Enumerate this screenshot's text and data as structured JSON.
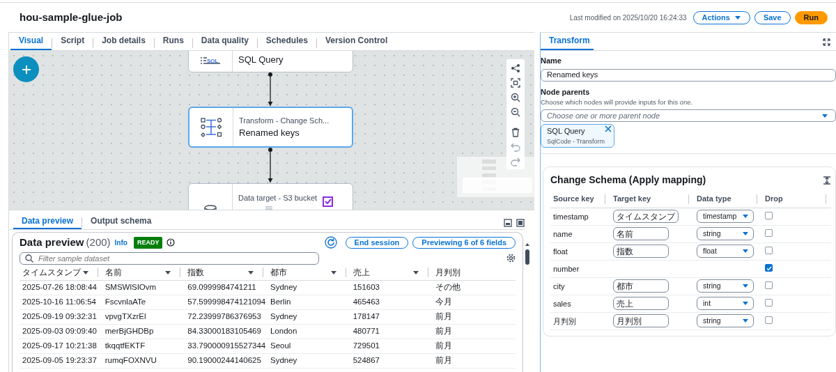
{
  "header": {
    "title": "hou-sample-glue-job",
    "last_modified": "Last modified on 2025/10/20 16:24:33",
    "buttons": [
      {
        "label": "Actions",
        "kind": "dropdown"
      },
      {
        "label": "Save",
        "kind": "outline"
      },
      {
        "label": "Run",
        "kind": "primary"
      }
    ]
  },
  "tabs": [
    {
      "label": "Visual",
      "selected": true
    },
    {
      "label": "Script",
      "selected": false
    },
    {
      "label": "Job details",
      "selected": false
    },
    {
      "label": "Runs",
      "selected": false
    },
    {
      "label": "Data quality",
      "selected": false
    },
    {
      "label": "Schedules",
      "selected": false
    },
    {
      "label": "Version Control",
      "selected": false
    }
  ],
  "canvas": {
    "nodes": [
      {
        "kind": "sql",
        "icon_label": "SQL",
        "title": "SQL Query",
        "selected": false
      },
      {
        "kind": "transform",
        "subtitle": "Transform - Change Sch...",
        "title": "Renamed keys",
        "selected": true
      },
      {
        "kind": "target",
        "subtitle": "Data target - S3 bucket",
        "selected": false
      }
    ]
  },
  "preview": {
    "tabs": [
      {
        "label": "Data preview",
        "selected": true
      },
      {
        "label": "Output schema",
        "selected": false
      }
    ],
    "title": "Data preview",
    "count": "(200)",
    "info": "Info",
    "status": "READY",
    "end_button": "End session",
    "fields_button": "Previewing 6 of 6 fields",
    "filter_placeholder": "Filter sample dataset",
    "columns": [
      "タイムスタンプ",
      "名前",
      "指数",
      "都市",
      "売上",
      "月判別"
    ],
    "rows": [
      [
        "2025-07-26 18:08:44",
        "SMSWlSIOvm",
        "69.0999984741211",
        "Sydney",
        "151603",
        "その他"
      ],
      [
        "2025-10-16 11:06:54",
        "FscvnlaATe",
        "57.599998474121094",
        "Berlin",
        "465463",
        "今月"
      ],
      [
        "2025-09-19 09:32:31",
        "vpvgTXzrEl",
        "72.23999786376953",
        "Sydney",
        "178147",
        "前月"
      ],
      [
        "2025-09-03 09:09:40",
        "merBjGHDBp",
        "84.33000183105469",
        "London",
        "480771",
        "前月"
      ],
      [
        "2025-09-17 10:21:38",
        "tkqqtfEKTF",
        "33.790000915527344",
        "Seoul",
        "729501",
        "前月"
      ],
      [
        "2025-09-05 19:23:37",
        "rumqFOXNVU",
        "90.19000244140625",
        "Sydney",
        "524867",
        "前月"
      ]
    ]
  },
  "panel": {
    "tab": {
      "label": "Transform",
      "selected": true
    },
    "name_label": "Name",
    "name_value": "Renamed keys",
    "parents_label": "Node parents",
    "parents_hint": "Choose which nodes will provide inputs for this one.",
    "parents_placeholder": "Choose one or more parent node",
    "parent_token": {
      "title": "SQL Query",
      "subtitle": "SqlCode - Transform"
    },
    "mapping_title": "Change Schema (Apply mapping)",
    "mapping_columns": [
      "Source key",
      "Target key",
      "Data type",
      "Drop"
    ],
    "mappings": [
      {
        "source": "timestamp",
        "target": "タイムスタンプ",
        "type": "timestamp",
        "drop": false
      },
      {
        "source": "name",
        "target": "名前",
        "type": "string",
        "drop": false
      },
      {
        "source": "float",
        "target": "指数",
        "type": "float",
        "drop": false
      },
      {
        "source": "number",
        "drop": true
      },
      {
        "source": "city",
        "target": "都市",
        "type": "string",
        "drop": false
      },
      {
        "source": "sales",
        "target": "売上",
        "type": "int",
        "drop": false
      },
      {
        "source": "月判別",
        "target": "月判別",
        "type": "string",
        "drop": false
      }
    ]
  }
}
